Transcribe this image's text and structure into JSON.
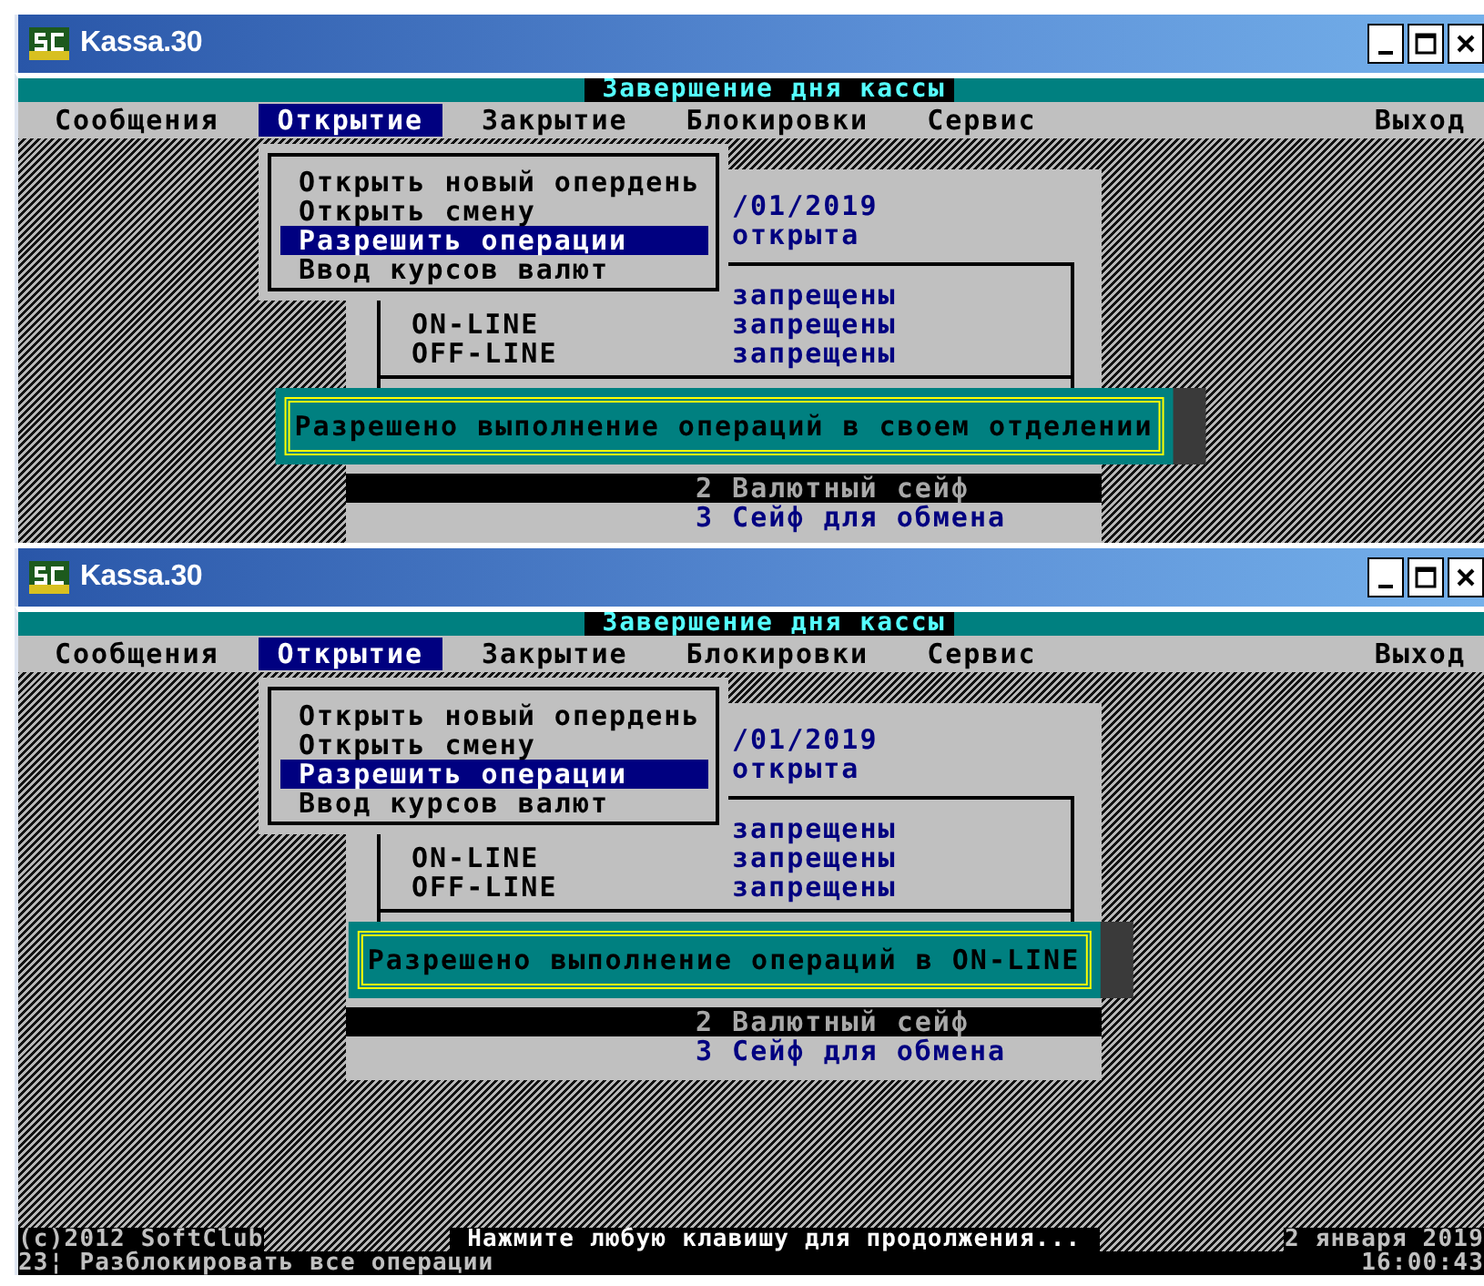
{
  "windows": [
    {
      "title": "Kassa.30",
      "screen_title": "Завершение дня кассы",
      "menu": [
        {
          "label": "Сообщения",
          "selected": false
        },
        {
          "label": "Открытие",
          "selected": true
        },
        {
          "label": "Закрытие",
          "selected": false
        },
        {
          "label": "Блокировки",
          "selected": false
        },
        {
          "label": "Сервис",
          "selected": false
        },
        {
          "label": "Выход",
          "selected": false
        }
      ],
      "dropdown": [
        {
          "label": "Открыть новый опердень",
          "selected": false
        },
        {
          "label": "Открыть смену",
          "selected": false
        },
        {
          "label": "Разрешить операции",
          "selected": true
        },
        {
          "label": "Ввод курсов валют",
          "selected": false
        }
      ],
      "date": "/01/2019",
      "day_status": "открыта",
      "operations": [
        {
          "value": "запрещены"
        },
        {
          "label": "ON-LINE",
          "value": "запрещены"
        },
        {
          "label": "OFF-LINE",
          "value": "запрещены"
        }
      ],
      "safes": [
        {
          "label": "2 Валютный сейф",
          "selected": true
        },
        {
          "label": "3 Сейф для обмена",
          "selected": false
        }
      ],
      "message": "Разрешено выполнение операций в своем отделении"
    },
    {
      "title": "Kassa.30",
      "screen_title": "Завершение дня кассы",
      "menu": [
        {
          "label": "Сообщения",
          "selected": false
        },
        {
          "label": "Открытие",
          "selected": true
        },
        {
          "label": "Закрытие",
          "selected": false
        },
        {
          "label": "Блокировки",
          "selected": false
        },
        {
          "label": "Сервис",
          "selected": false
        },
        {
          "label": "Выход",
          "selected": false
        }
      ],
      "dropdown": [
        {
          "label": "Открыть новый опердень",
          "selected": false
        },
        {
          "label": "Открыть смену",
          "selected": false
        },
        {
          "label": "Разрешить операции",
          "selected": true
        },
        {
          "label": "Ввод курсов валют",
          "selected": false
        }
      ],
      "date": "/01/2019",
      "day_status": "открыта",
      "operations": [
        {
          "value": "запрещены"
        },
        {
          "label": "ON-LINE",
          "value": "запрещены"
        },
        {
          "label": "OFF-LINE",
          "value": "запрещены"
        }
      ],
      "safes": [
        {
          "label": "2 Валютный сейф",
          "selected": true
        },
        {
          "label": "3 Сейф для обмена",
          "selected": false
        }
      ],
      "message": "Разрешено выполнение операций в ON-LINE",
      "status_bar": {
        "copyright": "(c)2012 SoftClub",
        "prompt": "Нажмите любую клавишу для продолжения...",
        "date": "2 января 2019",
        "hint": "23¦ Разблокировать все операции",
        "time": "16:00:43"
      }
    }
  ]
}
